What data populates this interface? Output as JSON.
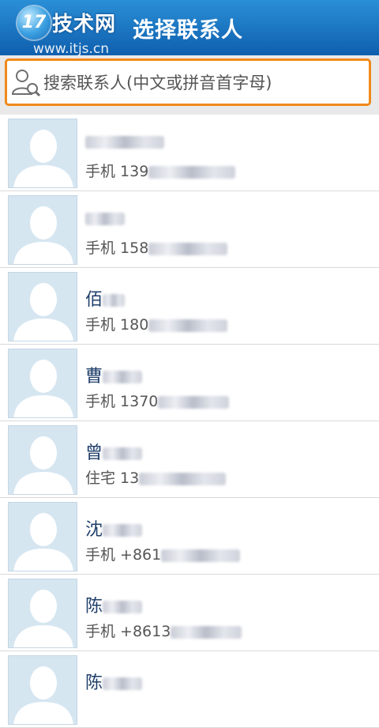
{
  "header": {
    "logo_badge": "17",
    "logo_text": "技术网",
    "logo_url": "www.itjs.cn",
    "title": "选择联系人"
  },
  "search": {
    "placeholder": "搜索联系人(中文或拼音首字母)"
  },
  "contacts": [
    {
      "name": "",
      "phone": "手机 139"
    },
    {
      "name": "",
      "phone": "手机 158"
    },
    {
      "name": "佰",
      "phone": "手机 180"
    },
    {
      "name": "曹",
      "phone": "手机 1370"
    },
    {
      "name": "曾",
      "phone": "住宅 13"
    },
    {
      "name": "沈",
      "phone": "手机 +861"
    },
    {
      "name": "陈",
      "phone": "手机 +8613"
    },
    {
      "name": "陈",
      "phone": ""
    }
  ],
  "colors": {
    "title_bar": "#1a72c2",
    "search_border": "#f0891a",
    "name_text": "#1e3e6a"
  }
}
